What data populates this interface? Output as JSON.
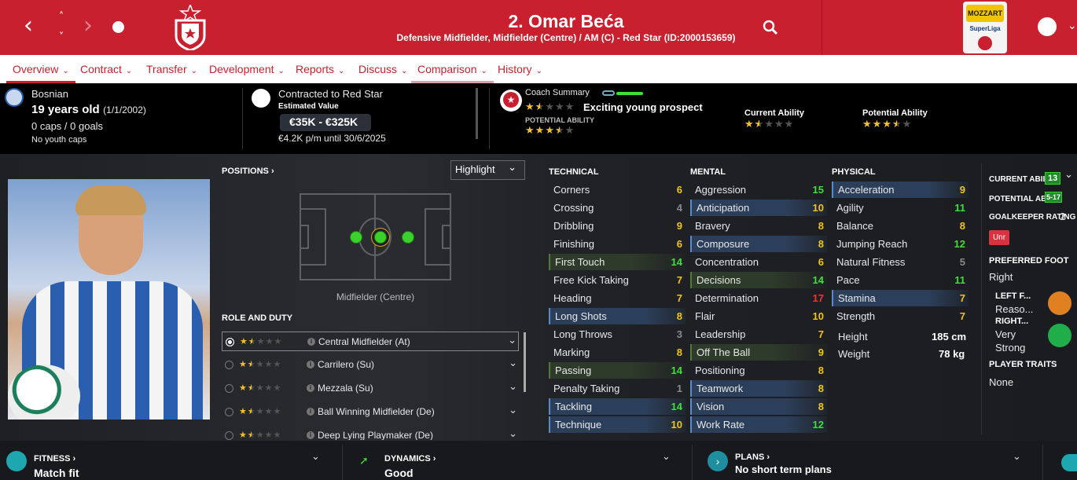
{
  "header": {
    "title": "2. Omar Beća",
    "subtitle": "Defensive Midfielder, Midfielder (Centre) / AM (C) - Red Star (ID:2000153659)",
    "league_logo_text": "MOZZART",
    "league_logo_sub": "SuperLiga",
    "colors": {
      "brand": "#c8202f"
    }
  },
  "tabs": [
    {
      "label": "Overview"
    },
    {
      "label": "Contract"
    },
    {
      "label": "Transfer"
    },
    {
      "label": "Development"
    },
    {
      "label": "Reports"
    },
    {
      "label": "Discuss"
    },
    {
      "label": "Comparison"
    },
    {
      "label": "History"
    }
  ],
  "info": {
    "nationality": "Bosnian",
    "age": "19 years old",
    "dob": "(1/1/2002)",
    "caps": "0 caps / 0 goals",
    "youth_caps": "No youth caps",
    "contract": "Contracted to Red Star",
    "estimated_value_label": "Estimated Value",
    "value": "€35K - €325K",
    "wage": "€4.2K p/m until 30/6/2025",
    "coach_summary_label": "Coach Summary",
    "coach_summary_text": "Exciting young prospect",
    "potential_ability_label": "POTENTIAL ABILITY",
    "current_ability_label": "Current Ability",
    "potential_ability_title": "Potential Ability",
    "current_stars": 1.5,
    "potential_stars": 3.5
  },
  "positions": {
    "label": "POSITIONS",
    "highlight": "Highlight",
    "selected_position": "Midfielder (Centre)"
  },
  "roles": {
    "label": "ROLE AND DUTY",
    "items": [
      {
        "name": "Central Midfielder (At)",
        "stars": 1.5
      },
      {
        "name": "Carrilero (Su)",
        "stars": 1.5
      },
      {
        "name": "Mezzala (Su)",
        "stars": 1.5
      },
      {
        "name": "Ball Winning Midfielder (De)",
        "stars": 1.5
      },
      {
        "name": "Deep Lying Playmaker (De)",
        "stars": 1.5
      }
    ]
  },
  "technical": {
    "label": "TECHNICAL",
    "items": [
      {
        "name": "Corners",
        "value": "6",
        "c": "c-y",
        "h": ""
      },
      {
        "name": "Crossing",
        "value": "4",
        "c": "c-gr",
        "h": ""
      },
      {
        "name": "Dribbling",
        "value": "9",
        "c": "c-y",
        "h": ""
      },
      {
        "name": "Finishing",
        "value": "6",
        "c": "c-y",
        "h": ""
      },
      {
        "name": "First Touch",
        "value": "14",
        "c": "c-g",
        "h": "green"
      },
      {
        "name": "Free Kick Taking",
        "value": "7",
        "c": "c-y",
        "h": ""
      },
      {
        "name": "Heading",
        "value": "7",
        "c": "c-y",
        "h": ""
      },
      {
        "name": "Long Shots",
        "value": "8",
        "c": "c-y",
        "h": "blue"
      },
      {
        "name": "Long Throws",
        "value": "3",
        "c": "c-gr",
        "h": ""
      },
      {
        "name": "Marking",
        "value": "8",
        "c": "c-y",
        "h": ""
      },
      {
        "name": "Passing",
        "value": "14",
        "c": "c-g",
        "h": "green"
      },
      {
        "name": "Penalty Taking",
        "value": "1",
        "c": "c-gr",
        "h": ""
      },
      {
        "name": "Tackling",
        "value": "14",
        "c": "c-g",
        "h": "blue"
      },
      {
        "name": "Technique",
        "value": "10",
        "c": "c-y",
        "h": "blue"
      }
    ]
  },
  "mental": {
    "label": "MENTAL",
    "items": [
      {
        "name": "Aggression",
        "value": "15",
        "c": "c-g",
        "h": ""
      },
      {
        "name": "Anticipation",
        "value": "10",
        "c": "c-y",
        "h": "blue"
      },
      {
        "name": "Bravery",
        "value": "8",
        "c": "c-y",
        "h": ""
      },
      {
        "name": "Composure",
        "value": "8",
        "c": "c-y",
        "h": "blue"
      },
      {
        "name": "Concentration",
        "value": "6",
        "c": "c-y",
        "h": ""
      },
      {
        "name": "Decisions",
        "value": "14",
        "c": "c-g",
        "h": "green"
      },
      {
        "name": "Determination",
        "value": "17",
        "c": "c-r",
        "h": ""
      },
      {
        "name": "Flair",
        "value": "10",
        "c": "c-y",
        "h": ""
      },
      {
        "name": "Leadership",
        "value": "7",
        "c": "c-y",
        "h": ""
      },
      {
        "name": "Off The Ball",
        "value": "9",
        "c": "c-y",
        "h": "green"
      },
      {
        "name": "Positioning",
        "value": "8",
        "c": "c-y",
        "h": ""
      },
      {
        "name": "Teamwork",
        "value": "8",
        "c": "c-y",
        "h": "blue"
      },
      {
        "name": "Vision",
        "value": "8",
        "c": "c-y",
        "h": "blue"
      },
      {
        "name": "Work Rate",
        "value": "12",
        "c": "c-g",
        "h": "blue"
      }
    ]
  },
  "physical": {
    "label": "PHYSICAL",
    "items": [
      {
        "name": "Acceleration",
        "value": "9",
        "c": "c-y",
        "h": "blue"
      },
      {
        "name": "Agility",
        "value": "11",
        "c": "c-g",
        "h": ""
      },
      {
        "name": "Balance",
        "value": "8",
        "c": "c-y",
        "h": ""
      },
      {
        "name": "Jumping Reach",
        "value": "12",
        "c": "c-g",
        "h": ""
      },
      {
        "name": "Natural Fitness",
        "value": "5",
        "c": "c-gr",
        "h": ""
      },
      {
        "name": "Pace",
        "value": "11",
        "c": "c-g",
        "h": ""
      },
      {
        "name": "Stamina",
        "value": "7",
        "c": "c-y",
        "h": "blue"
      },
      {
        "name": "Strength",
        "value": "7",
        "c": "c-y",
        "h": ""
      }
    ],
    "height_label": "Height",
    "height": "185 cm",
    "weight_label": "Weight",
    "weight": "78 kg"
  },
  "side": {
    "current_ability_label": "CURRENT ABILITY",
    "current_ability": "13",
    "potential_ability_label": "POTENTIAL ABILI...",
    "potential_ability": "5-17",
    "gk_label": "GOALKEEPER RATING",
    "gk": "2",
    "unr": "Unr",
    "foot_label": "PREFERRED FOOT",
    "foot": "Right",
    "left_label": "LEFT F...",
    "left_value": "Reaso...",
    "right_label": "RIGHT...",
    "right_value_1": "Very",
    "right_value_2": "Strong",
    "traits_label": "PLAYER TRAITS",
    "traits": "None"
  },
  "bottom": {
    "fitness_label": "FITNESS",
    "fitness": "Match fit",
    "dynamics_label": "DYNAMICS",
    "dynamics": "Good",
    "plans_label": "PLANS",
    "plans": "No short term plans"
  }
}
